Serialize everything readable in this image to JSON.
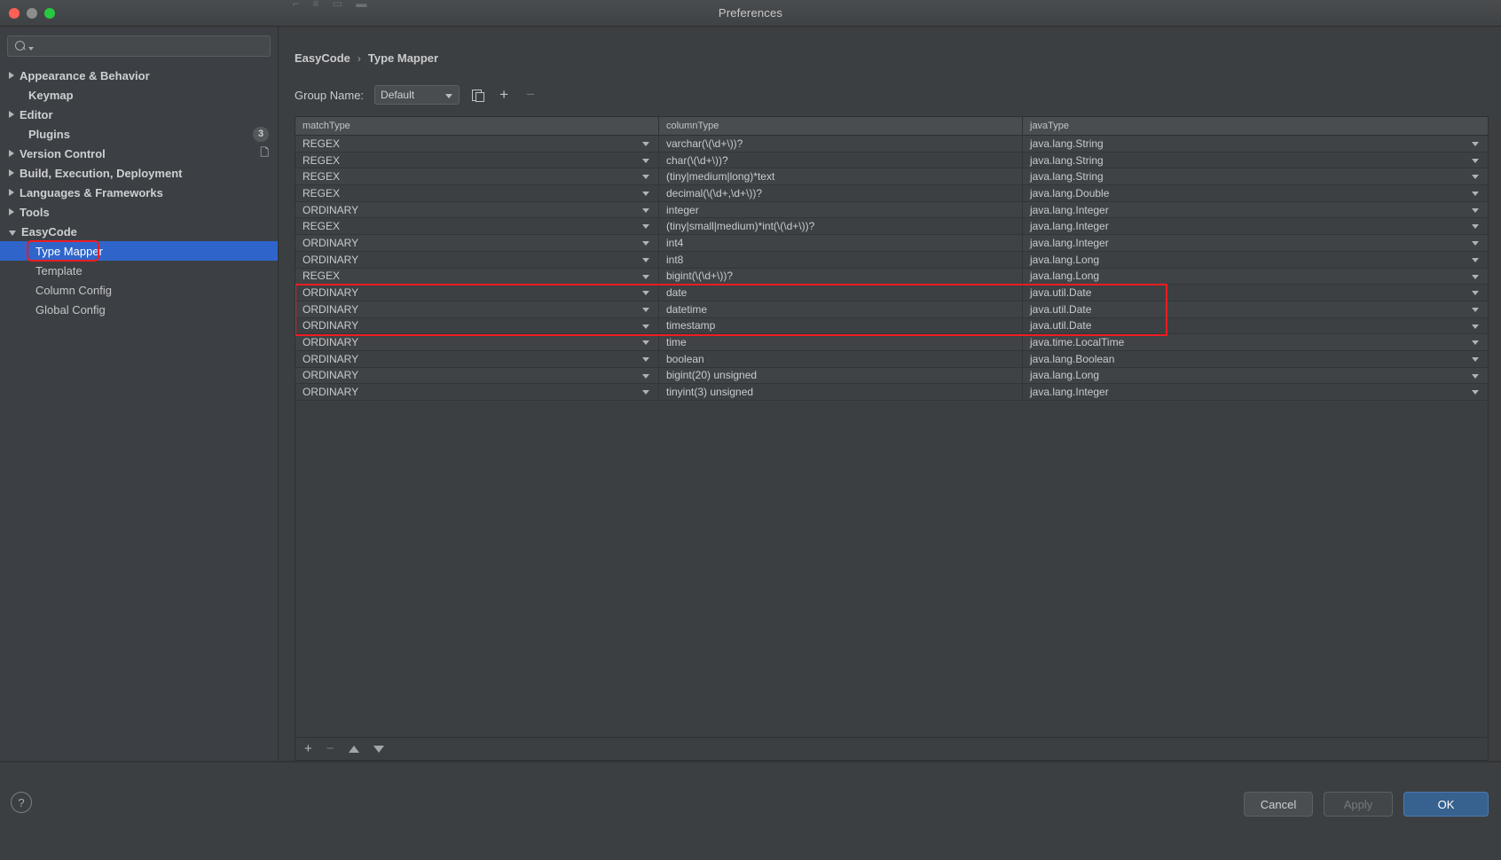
{
  "window": {
    "title": "Preferences",
    "traffic_lights": [
      "close",
      "minimize",
      "zoom"
    ]
  },
  "sidebar": {
    "search": {
      "value": "",
      "placeholder": ""
    },
    "items": [
      {
        "label": "Appearance & Behavior",
        "expandable": true,
        "expanded": false,
        "level": 0,
        "bold": true
      },
      {
        "label": "Keymap",
        "expandable": false,
        "expanded": false,
        "level": 0,
        "bold": true
      },
      {
        "label": "Editor",
        "expandable": true,
        "expanded": false,
        "level": 0,
        "bold": true
      },
      {
        "label": "Plugins",
        "expandable": false,
        "expanded": false,
        "level": 0,
        "bold": true,
        "badge": "3"
      },
      {
        "label": "Version Control",
        "expandable": true,
        "expanded": false,
        "level": 0,
        "bold": true,
        "trailing_icon": "copy-icon"
      },
      {
        "label": "Build, Execution, Deployment",
        "expandable": true,
        "expanded": false,
        "level": 0,
        "bold": true
      },
      {
        "label": "Languages & Frameworks",
        "expandable": true,
        "expanded": false,
        "level": 0,
        "bold": true
      },
      {
        "label": "Tools",
        "expandable": true,
        "expanded": false,
        "level": 0,
        "bold": true
      },
      {
        "label": "EasyCode",
        "expandable": true,
        "expanded": true,
        "level": 0,
        "bold": true
      },
      {
        "label": "Type Mapper",
        "expandable": false,
        "expanded": false,
        "level": 1,
        "bold": false,
        "selected": true,
        "highlighted": true
      },
      {
        "label": "Template",
        "expandable": false,
        "expanded": false,
        "level": 1,
        "bold": false
      },
      {
        "label": "Column Config",
        "expandable": false,
        "expanded": false,
        "level": 1,
        "bold": false
      },
      {
        "label": "Global Config",
        "expandable": false,
        "expanded": false,
        "level": 1,
        "bold": false
      }
    ]
  },
  "breadcrumb": {
    "root": "EasyCode",
    "separator": "›",
    "current": "Type Mapper"
  },
  "toolbar": {
    "group_label": "Group Name:",
    "group_value": "Default",
    "copy_title": "copy-group",
    "add_title": "add-group",
    "remove_title": "remove-group"
  },
  "table": {
    "headers": [
      "matchType",
      "columnType",
      "javaType"
    ],
    "rows": [
      {
        "matchType": "REGEX",
        "columnType": "varchar(\\(\\d+\\))?",
        "javaType": "java.lang.String"
      },
      {
        "matchType": "REGEX",
        "columnType": "char(\\(\\d+\\))?",
        "javaType": "java.lang.String"
      },
      {
        "matchType": "REGEX",
        "columnType": "(tiny|medium|long)*text",
        "javaType": "java.lang.String"
      },
      {
        "matchType": "REGEX",
        "columnType": "decimal(\\(\\d+,\\d+\\))?",
        "javaType": "java.lang.Double"
      },
      {
        "matchType": "ORDINARY",
        "columnType": "integer",
        "javaType": "java.lang.Integer"
      },
      {
        "matchType": "REGEX",
        "columnType": "(tiny|small|medium)*int(\\(\\d+\\))?",
        "javaType": "java.lang.Integer"
      },
      {
        "matchType": "ORDINARY",
        "columnType": "int4",
        "javaType": "java.lang.Integer"
      },
      {
        "matchType": "ORDINARY",
        "columnType": "int8",
        "javaType": "java.lang.Long"
      },
      {
        "matchType": "REGEX",
        "columnType": "bigint(\\(\\d+\\))?",
        "javaType": "java.lang.Long"
      },
      {
        "matchType": "ORDINARY",
        "columnType": "date",
        "javaType": "java.util.Date",
        "highlighted": true
      },
      {
        "matchType": "ORDINARY",
        "columnType": "datetime",
        "javaType": "java.util.Date",
        "highlighted": true
      },
      {
        "matchType": "ORDINARY",
        "columnType": "timestamp",
        "javaType": "java.util.Date",
        "highlighted": true
      },
      {
        "matchType": "ORDINARY",
        "columnType": "time",
        "javaType": "java.time.LocalTime"
      },
      {
        "matchType": "ORDINARY",
        "columnType": "boolean",
        "javaType": "java.lang.Boolean"
      },
      {
        "matchType": "ORDINARY",
        "columnType": "bigint(20) unsigned",
        "javaType": "java.lang.Long"
      },
      {
        "matchType": "ORDINARY",
        "columnType": "tinyint(3) unsigned",
        "javaType": "java.lang.Integer"
      }
    ]
  },
  "table_footer": {
    "add": "+",
    "remove": "−",
    "move_up": "move-up",
    "move_down": "move-down"
  },
  "footer": {
    "help": "?",
    "cancel": "Cancel",
    "apply": "Apply",
    "ok": "OK"
  },
  "colors": {
    "accent_selection": "#2f65ca",
    "highlight_red": "#ee1c22",
    "ok_button": "#37618e",
    "window_bg": "#3c3f41"
  }
}
